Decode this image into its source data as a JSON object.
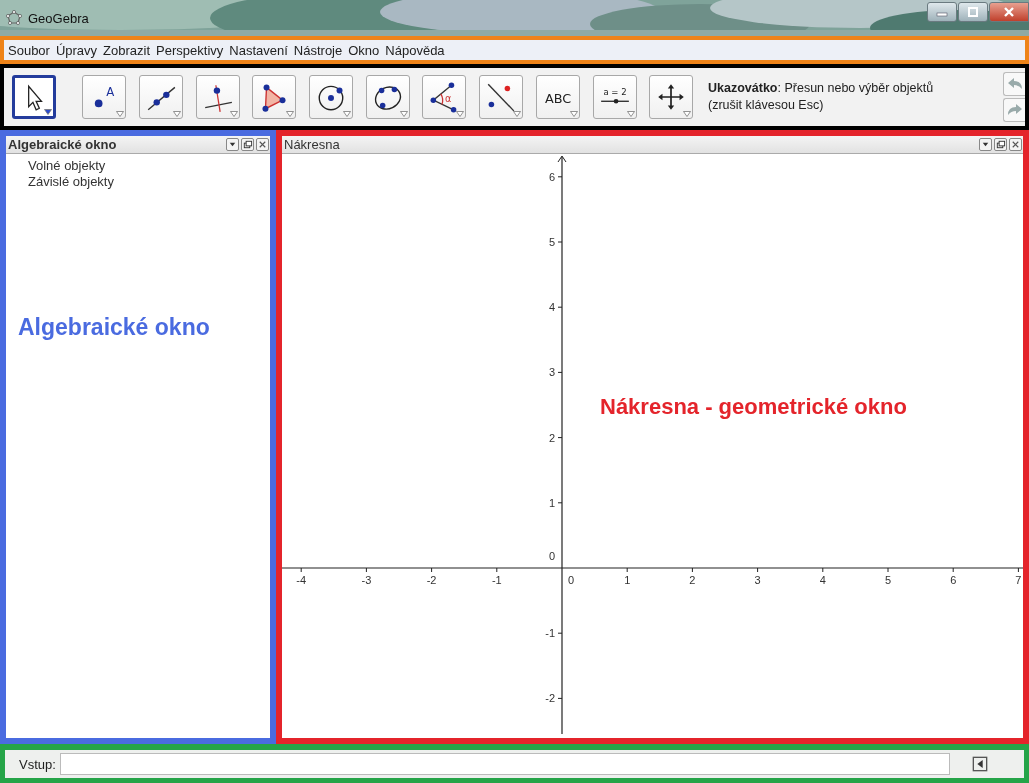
{
  "window": {
    "title": "GeoGebra"
  },
  "menu": [
    "Soubor",
    "Úpravy",
    "Zobrazit",
    "Perspektivy",
    "Nastavení",
    "Nástroje",
    "Okno",
    "Nápověda"
  ],
  "toolbar": {
    "tool_groups": [
      [
        {
          "kind": "pointer",
          "selected": true
        }
      ],
      [
        {
          "kind": "point",
          "label": "A",
          "selected": false
        },
        {
          "kind": "line",
          "selected": false
        },
        {
          "kind": "perpendicular",
          "selected": false
        }
      ],
      [
        {
          "kind": "polygon",
          "selected": false
        },
        {
          "kind": "circle",
          "selected": false
        },
        {
          "kind": "conic",
          "selected": false
        }
      ],
      [
        {
          "kind": "angle",
          "label": "α",
          "selected": false
        },
        {
          "kind": "reflect",
          "selected": false
        },
        {
          "kind": "text",
          "label": "ABC",
          "selected": false
        },
        {
          "kind": "slider",
          "label": "a = 2",
          "selected": false
        }
      ],
      [
        {
          "kind": "move_view",
          "selected": false
        }
      ]
    ],
    "help": "**Ukazovátko**: Přesun nebo výběr objektů (zrušit klávesou Esc)"
  },
  "algebra_view": {
    "title": "Algebraické okno",
    "items": [
      "Volné objekty",
      "Závislé objekty"
    ],
    "annotation": "Algebraické okno"
  },
  "graphics_view": {
    "title": "Nákresna",
    "x_ticks": [
      "-4",
      "-3",
      "-2",
      "-1",
      "0",
      "1",
      "2",
      "3",
      "4",
      "5",
      "6",
      "7"
    ],
    "y_ticks": [
      "6",
      "5",
      "4",
      "3",
      "2",
      "1",
      "0",
      "-1",
      "-2"
    ],
    "annotation": "Nákresna - geometrické okno"
  },
  "input_bar": {
    "label": "Vstup:"
  }
}
